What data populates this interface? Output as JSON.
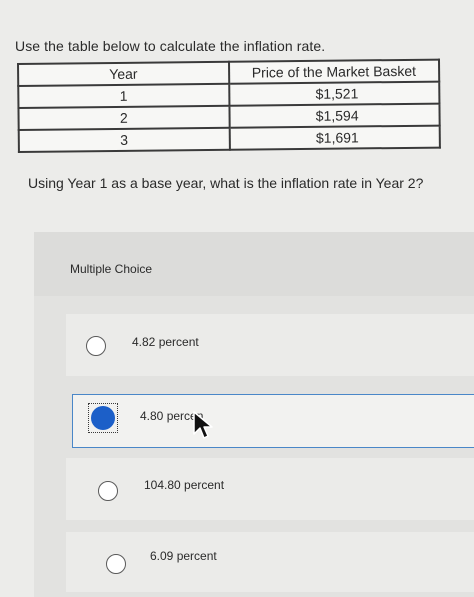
{
  "question": "Use the table below to calculate the inflation rate.",
  "table": {
    "headers": [
      "Year",
      "Price of the Market Basket"
    ],
    "rows": [
      [
        "1",
        "$1,521"
      ],
      [
        "2",
        "$1,594"
      ],
      [
        "3",
        "$1,691"
      ]
    ]
  },
  "subquestion": "Using Year 1 as a base year, what is the inflation rate in Year 2?",
  "multiple_choice": {
    "label": "Multiple Choice",
    "options": [
      {
        "text": "4.82 percent",
        "selected": false
      },
      {
        "text": "4.80 percen",
        "selected": true
      },
      {
        "text": "104.80 percent",
        "selected": false
      },
      {
        "text": "6.09 percent",
        "selected": false
      }
    ]
  },
  "colors": {
    "selected_radio": "#1c5fc8",
    "selected_border": "#4a87c8"
  },
  "icons": {
    "cursor": "arrow-cursor-icon"
  }
}
